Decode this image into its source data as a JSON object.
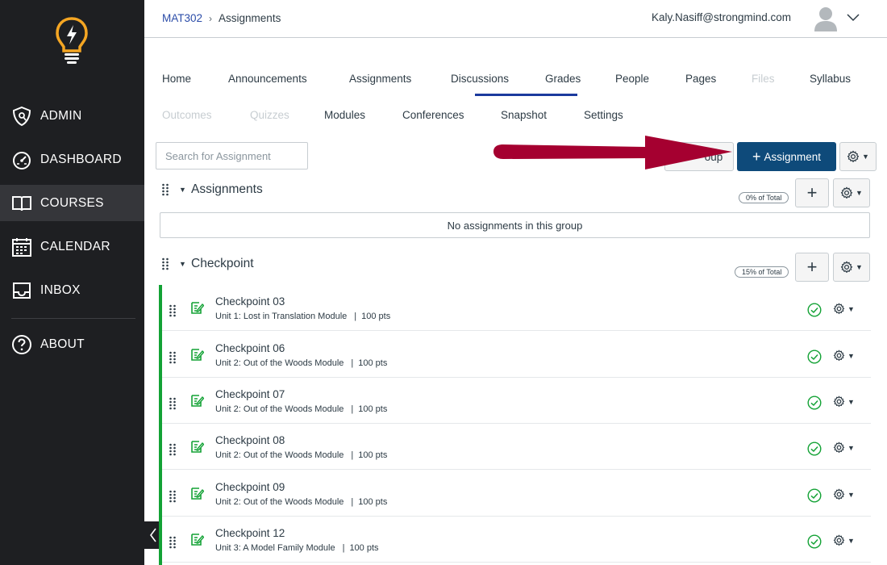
{
  "sidebar": {
    "items": [
      {
        "label": "ADMIN",
        "icon": "shield-icon"
      },
      {
        "label": "DASHBOARD",
        "icon": "dashboard-gauge-icon"
      },
      {
        "label": "COURSES",
        "icon": "book-icon"
      },
      {
        "label": "CALENDAR",
        "icon": "calendar-icon"
      },
      {
        "label": "INBOX",
        "icon": "inbox-icon"
      },
      {
        "label": "ABOUT",
        "icon": "question-icon"
      }
    ],
    "active": "COURSES",
    "logo_icon": "lightbulb-logo-icon",
    "accent_color": "#f5a623"
  },
  "header": {
    "breadcrumb": {
      "course": "MAT302",
      "current": "Assignments"
    },
    "user_email": "Kaly.Nasiff@strongmind.com"
  },
  "course_nav": {
    "row1": [
      "Home",
      "Announcements",
      "Assignments",
      "Discussions",
      "Grades",
      "People",
      "Pages",
      "Files",
      "Syllabus"
    ],
    "row2": [
      "Outcomes",
      "Quizzes",
      "Modules",
      "Conferences",
      "Snapshot",
      "Settings"
    ],
    "active": "Assignments",
    "disabled": [
      "Files",
      "Outcomes",
      "Quizzes"
    ]
  },
  "toolbar": {
    "search_placeholder": "Search for Assignment",
    "group_button": "oup",
    "add_assignment_button": "Assignment",
    "primary_color": "#0e4a7a"
  },
  "groups": [
    {
      "title": "Assignments",
      "percent": "0% of Total",
      "empty_message": "No assignments in this group"
    },
    {
      "title": "Checkpoint",
      "percent": "15% of Total"
    }
  ],
  "assignments": [
    {
      "title": "Checkpoint 03",
      "module": "Unit 1: Lost in Translation Module",
      "points": "100 pts"
    },
    {
      "title": "Checkpoint 06",
      "module": "Unit 2: Out of the Woods Module",
      "points": "100 pts"
    },
    {
      "title": "Checkpoint 07",
      "module": "Unit 2: Out of the Woods Module",
      "points": "100 pts"
    },
    {
      "title": "Checkpoint 08",
      "module": "Unit 2: Out of the Woods Module",
      "points": "100 pts"
    },
    {
      "title": "Checkpoint 09",
      "module": "Unit 2: Out of the Woods Module",
      "points": "100 pts"
    },
    {
      "title": "Checkpoint 12",
      "module": "Unit 3: A Model Family Module",
      "points": "100 pts"
    }
  ],
  "separator": "|",
  "published_color": "#13a235",
  "annotation_arrow_color": "#a50030"
}
